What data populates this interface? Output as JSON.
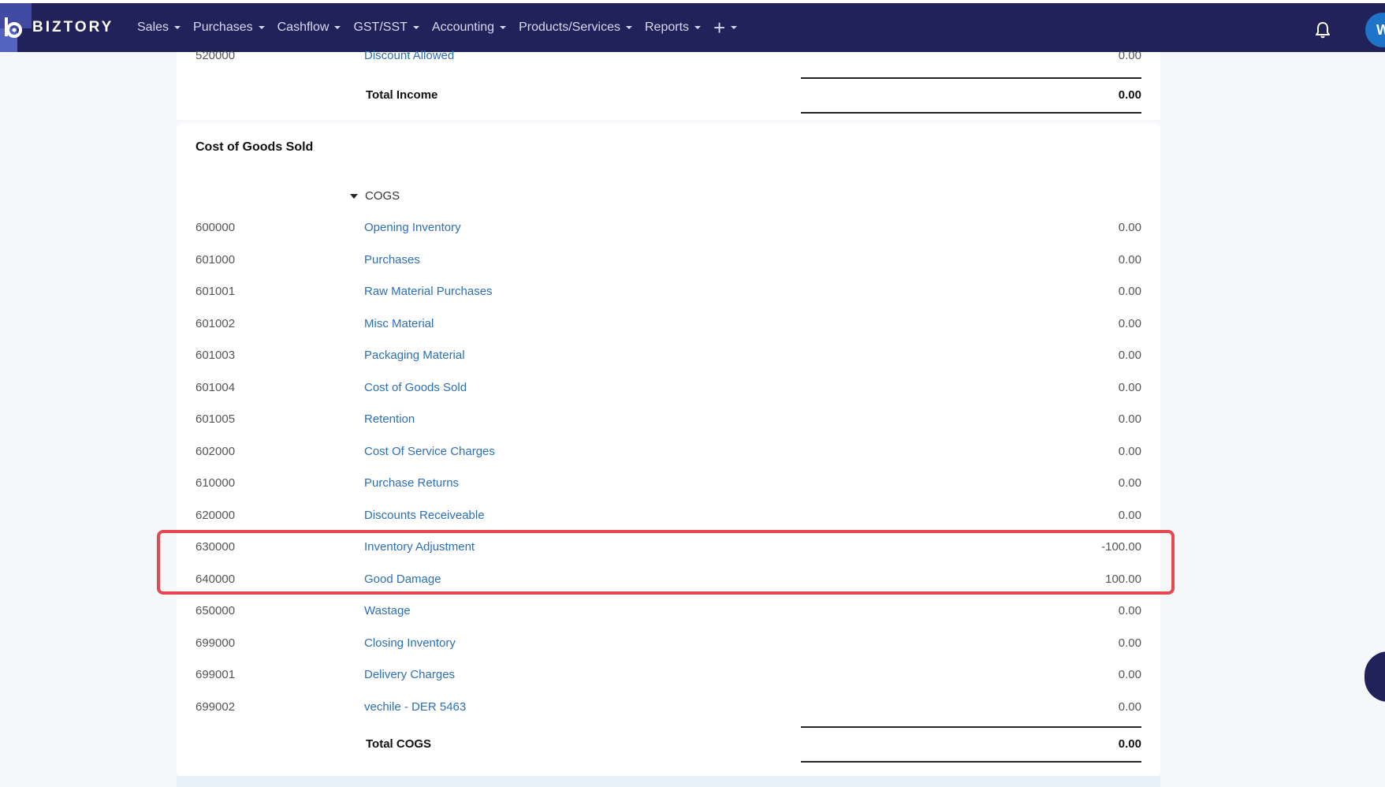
{
  "brand": {
    "name": "BIZTORY"
  },
  "nav": {
    "items": [
      {
        "label": "Sales"
      },
      {
        "label": "Purchases"
      },
      {
        "label": "Cashflow"
      },
      {
        "label": "GST/SST"
      },
      {
        "label": "Accounting"
      },
      {
        "label": "Products/Services"
      },
      {
        "label": "Reports"
      }
    ],
    "plus": "+"
  },
  "user": {
    "avatar_initial": "W"
  },
  "income": {
    "partial_row": {
      "code": "520000",
      "name": "Discount Allowed",
      "amount": "0.00"
    },
    "total_label": "Total Income",
    "total_amount": "0.00"
  },
  "cogs": {
    "section_title": "Cost of Goods Sold",
    "group_label": "COGS",
    "rows": [
      {
        "code": "600000",
        "name": "Opening Inventory",
        "amount": "0.00"
      },
      {
        "code": "601000",
        "name": "Purchases",
        "amount": "0.00"
      },
      {
        "code": "601001",
        "name": "Raw Material Purchases",
        "amount": "0.00"
      },
      {
        "code": "601002",
        "name": "Misc Material",
        "amount": "0.00"
      },
      {
        "code": "601003",
        "name": "Packaging Material",
        "amount": "0.00"
      },
      {
        "code": "601004",
        "name": "Cost of Goods Sold",
        "amount": "0.00"
      },
      {
        "code": "601005",
        "name": "Retention",
        "amount": "0.00"
      },
      {
        "code": "602000",
        "name": "Cost Of Service Charges",
        "amount": "0.00"
      },
      {
        "code": "610000",
        "name": "Purchase Returns",
        "amount": "0.00"
      },
      {
        "code": "620000",
        "name": "Discounts Receiveable",
        "amount": "0.00"
      },
      {
        "code": "630000",
        "name": "Inventory Adjustment",
        "amount": "-100.00"
      },
      {
        "code": "640000",
        "name": "Good Damage",
        "amount": "100.00"
      },
      {
        "code": "650000",
        "name": "Wastage",
        "amount": "0.00"
      },
      {
        "code": "699000",
        "name": "Closing Inventory",
        "amount": "0.00"
      },
      {
        "code": "699001",
        "name": "Delivery Charges",
        "amount": "0.00"
      },
      {
        "code": "699002",
        "name": "vechile - DER 5463",
        "amount": "0.00"
      }
    ],
    "total_label": "Total COGS",
    "total_amount": "0.00"
  },
  "colors": {
    "navbar": "#22225a",
    "link": "#2d6fb7",
    "highlight": "#e5484d"
  }
}
